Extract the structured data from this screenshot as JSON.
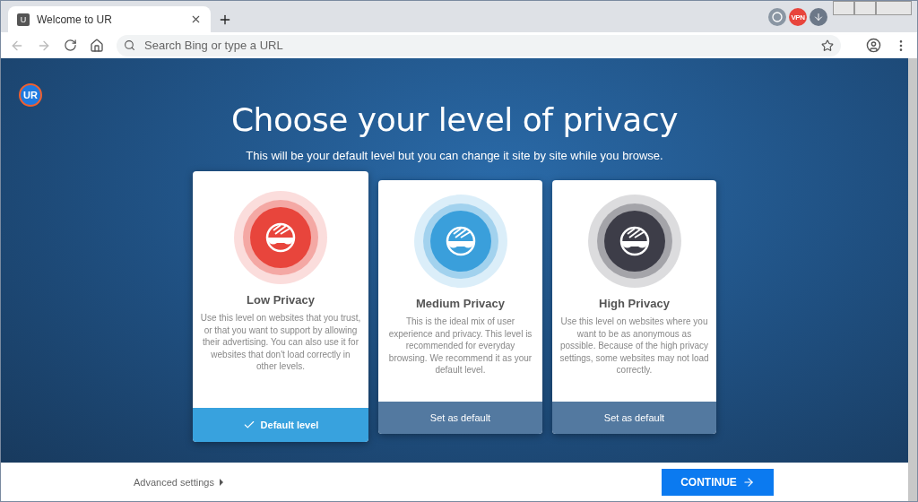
{
  "browser": {
    "tab": {
      "favicon": "U",
      "title": "Welcome to UR"
    },
    "extensions": {
      "vpn_label": "VPN"
    },
    "address": {
      "placeholder": "Search Bing or type a URL"
    }
  },
  "page": {
    "logo": "UR",
    "title": "Choose your level of privacy",
    "subtitle": "This will be your default level but you can change it site by site while you browse.",
    "levels": [
      {
        "name": "Low Privacy",
        "color": "#e8453c",
        "description": "Use this level on websites that you trust, or that you want to support by allowing their advertising. You can also use it for websites that don't load correctly in other levels.",
        "action": "Default level",
        "selected": true
      },
      {
        "name": "Medium Privacy",
        "color": "#3a9fdb",
        "description": "This is the ideal mix of user experience and privacy. This level is recommended for everyday browsing. We recommend it as your default level.",
        "action": "Set as default",
        "selected": false
      },
      {
        "name": "High Privacy",
        "color": "#3d3d48",
        "description": "Use this level on websites where you want to be as anonymous as possible. Because of the high privacy settings, some websites may not load correctly.",
        "action": "Set as default",
        "selected": false
      }
    ]
  },
  "footer": {
    "advanced": "Advanced settings",
    "continue": "CONTINUE"
  }
}
